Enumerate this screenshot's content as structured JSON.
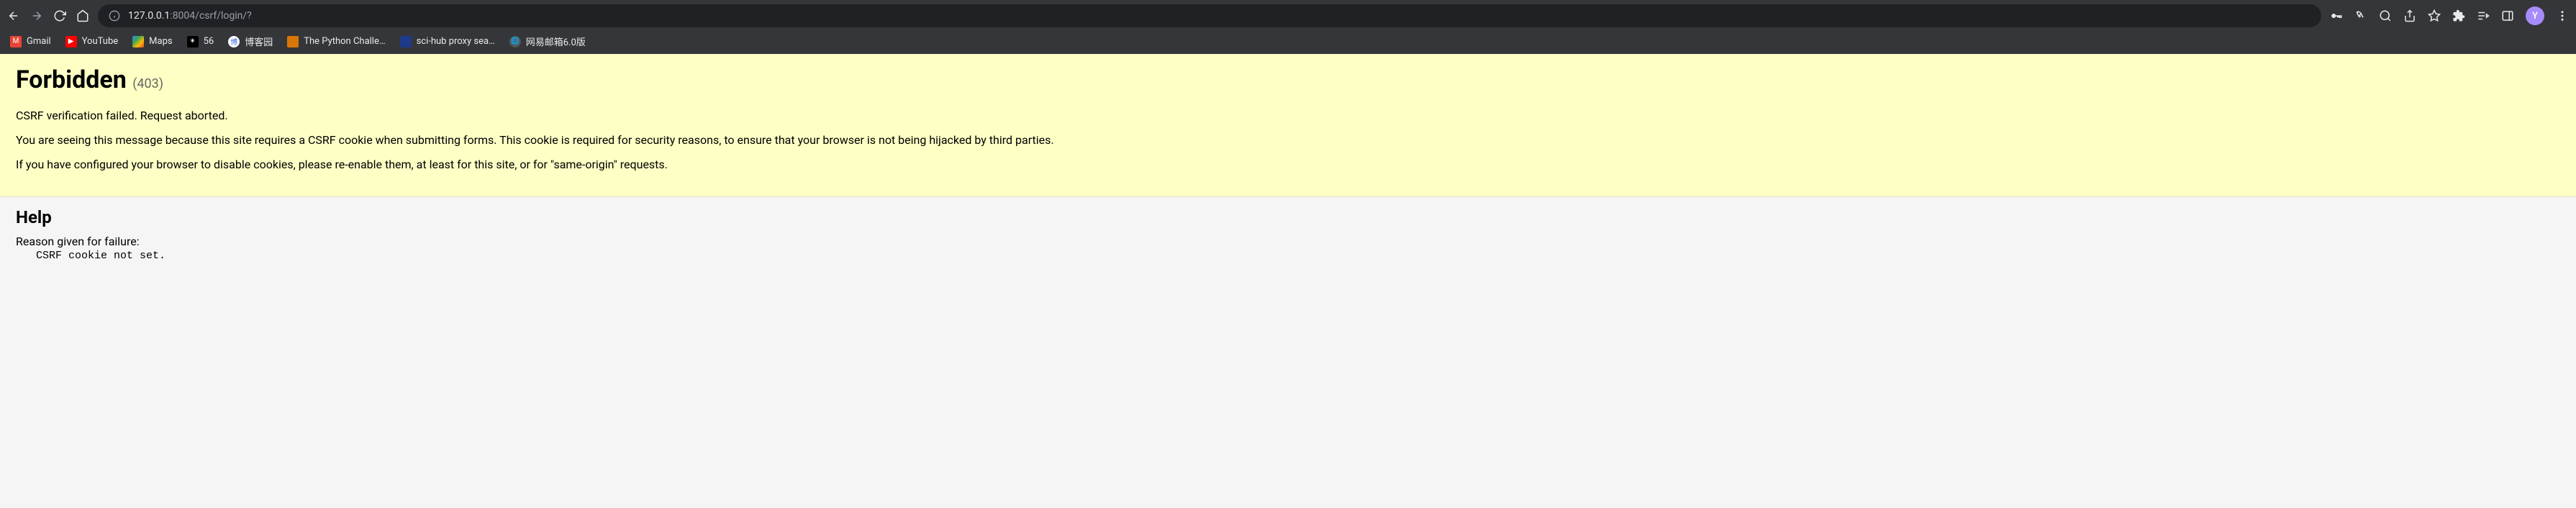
{
  "toolbar": {
    "url_host": "127.0.0.1",
    "url_port": ":8004",
    "url_path": "/csrf/login/?",
    "avatar_letter": "Y"
  },
  "bookmarks": [
    {
      "label": "Gmail"
    },
    {
      "label": "YouTube"
    },
    {
      "label": "Maps"
    },
    {
      "label": "56"
    },
    {
      "label": "博客园"
    },
    {
      "label": "The Python Challe…"
    },
    {
      "label": "sci-hub proxy sea…"
    },
    {
      "label": "网易邮箱6.0版"
    }
  ],
  "error": {
    "title": "Forbidden",
    "code": "(403)",
    "p1": "CSRF verification failed. Request aborted.",
    "p2": "You are seeing this message because this site requires a CSRF cookie when submitting forms. This cookie is required for security reasons, to ensure that your browser is not being hijacked by third parties.",
    "p3": "If you have configured your browser to disable cookies, please re-enable them, at least for this site, or for \"same-origin\" requests."
  },
  "help": {
    "title": "Help",
    "reason_label": "Reason given for failure:",
    "reason_code": "CSRF cookie not set."
  }
}
